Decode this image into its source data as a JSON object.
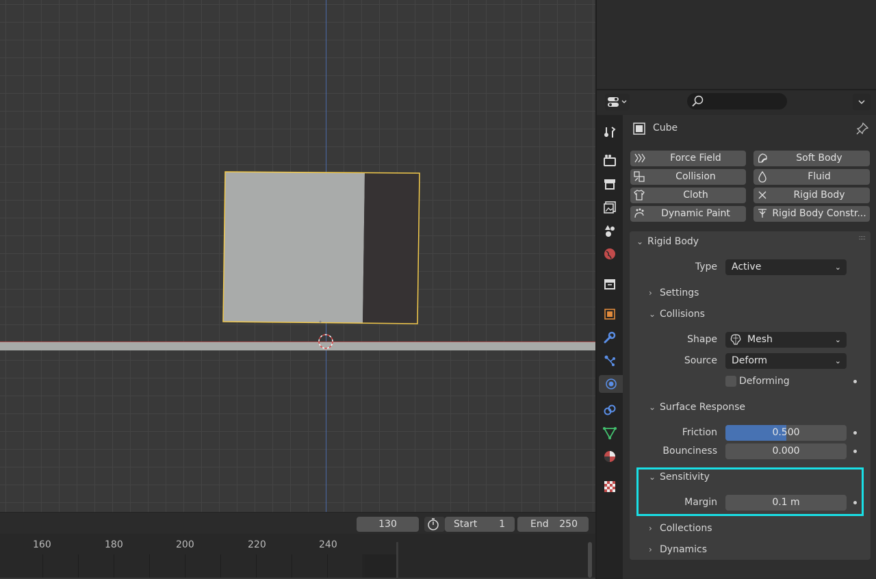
{
  "timeline": {
    "current_frame": "130",
    "start_label": "Start",
    "start_value": "1",
    "end_label": "End",
    "end_value": "250",
    "ruler": [
      "160",
      "180",
      "200",
      "220",
      "240"
    ]
  },
  "properties": {
    "object_name": "Cube",
    "physics_buttons": {
      "force_field": "Force Field",
      "soft_body": "Soft Body",
      "collision": "Collision",
      "fluid": "Fluid",
      "cloth": "Cloth",
      "rigid_body": "Rigid Body",
      "dynamic_paint": "Dynamic Paint",
      "rigid_body_constraint": "Rigid Body Constr..."
    },
    "rigid_body": {
      "title": "Rigid Body",
      "type_label": "Type",
      "type_value": "Active",
      "settings_label": "Settings",
      "collisions": {
        "title": "Collisions",
        "shape_label": "Shape",
        "shape_value": "Mesh",
        "source_label": "Source",
        "source_value": "Deform",
        "deforming_label": "Deforming",
        "deforming_checked": false
      },
      "surface_response": {
        "title": "Surface Response",
        "friction_label": "Friction",
        "friction_value": "0.500",
        "friction_fraction": 0.5,
        "bounciness_label": "Bounciness",
        "bounciness_value": "0.000"
      },
      "sensitivity": {
        "title": "Sensitivity",
        "margin_label": "Margin",
        "margin_value": "0.1 m"
      },
      "collections_label": "Collections",
      "dynamics_label": "Dynamics"
    }
  },
  "colors": {
    "accent_blue": "#4772b3",
    "selection_outline": "#f2c94c",
    "highlight_box": "#19e0e6"
  }
}
